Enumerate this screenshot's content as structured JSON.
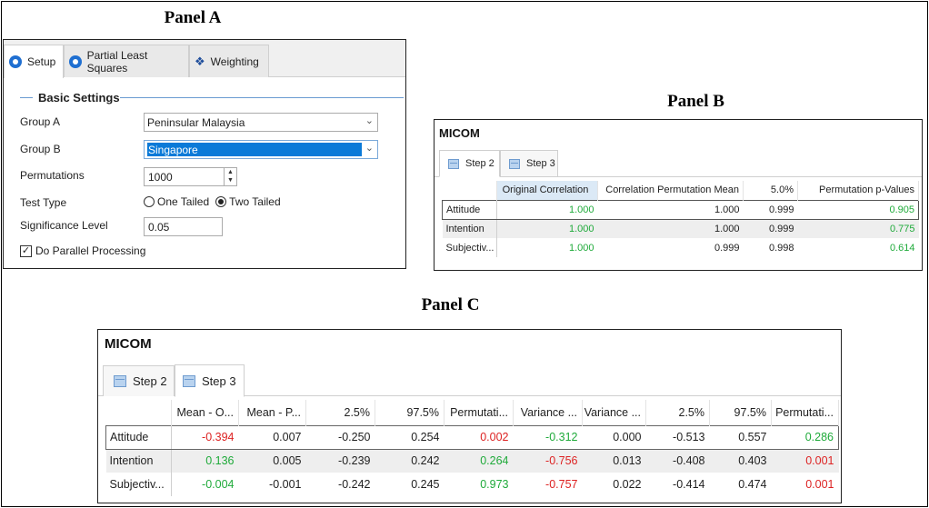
{
  "panel_a": {
    "title": "Panel A",
    "tabs": [
      {
        "label": "Setup",
        "icon": "gear-icon"
      },
      {
        "label": "Partial Least Squares",
        "icon": "gear-icon"
      },
      {
        "label": "Weighting",
        "icon": "people-icon"
      }
    ],
    "section_title": "Basic Settings",
    "group_a": {
      "label": "Group A",
      "value": "Peninsular Malaysia"
    },
    "group_b": {
      "label": "Group B",
      "value": "Singapore"
    },
    "permutations": {
      "label": "Permutations",
      "value": "1000"
    },
    "test_type": {
      "label": "Test Type",
      "options": [
        "One Tailed",
        "Two Tailed"
      ],
      "selected": "Two Tailed"
    },
    "significance": {
      "label": "Significance Level",
      "value": "0.05"
    },
    "parallel": {
      "label": "Do Parallel Processing",
      "checked": true
    }
  },
  "panel_b": {
    "title": "Panel B",
    "window_title": "MICOM",
    "tabs": [
      "Step 2",
      "Step 3"
    ],
    "active_tab": "Step 2",
    "columns": [
      "Original Correlation",
      "Correlation Permutation Mean",
      "5.0%",
      "Permutation p-Values"
    ],
    "rows": [
      {
        "name": "Attitude",
        "cells": [
          "1.000",
          "1.000",
          "0.999",
          "0.905"
        ]
      },
      {
        "name": "Intention",
        "cells": [
          "1.000",
          "1.000",
          "0.999",
          "0.775"
        ]
      },
      {
        "name": "Subjectiv...",
        "cells": [
          "1.000",
          "0.999",
          "0.998",
          "0.614"
        ]
      }
    ]
  },
  "panel_c": {
    "title": "Panel C",
    "window_title": "MICOM",
    "tabs": [
      "Step 2",
      "Step 3"
    ],
    "active_tab": "Step 3",
    "columns": [
      "Mean - O...",
      "Mean - P...",
      "2.5%",
      "97.5%",
      "Permutati...",
      "Variance ...",
      "Variance ...",
      "2.5%",
      "97.5%",
      "Permutati..."
    ],
    "rows": [
      {
        "name": "Attitude",
        "cells": [
          "-0.394",
          "0.007",
          "-0.250",
          "0.254",
          "0.002",
          "-0.312",
          "0.000",
          "-0.513",
          "0.557",
          "0.286"
        ]
      },
      {
        "name": "Intention",
        "cells": [
          "0.136",
          "0.005",
          "-0.239",
          "0.242",
          "0.264",
          "-0.756",
          "0.013",
          "-0.408",
          "0.403",
          "0.001"
        ]
      },
      {
        "name": "Subjectiv...",
        "cells": [
          "-0.004",
          "-0.001",
          "-0.242",
          "0.245",
          "0.973",
          "-0.757",
          "0.022",
          "-0.414",
          "0.474",
          "0.001"
        ]
      }
    ]
  },
  "colors": {
    "green": "#1faa3a",
    "red": "#dd2222",
    "selection": "#0a7ad8"
  }
}
